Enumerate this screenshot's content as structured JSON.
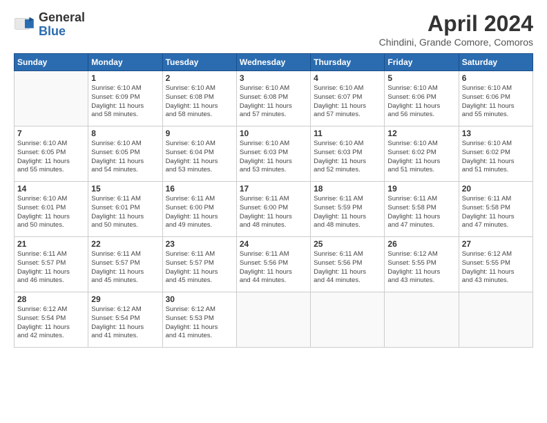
{
  "header": {
    "logo_general": "General",
    "logo_blue": "Blue",
    "month_title": "April 2024",
    "location": "Chindini, Grande Comore, Comoros"
  },
  "days_of_week": [
    "Sunday",
    "Monday",
    "Tuesday",
    "Wednesday",
    "Thursday",
    "Friday",
    "Saturday"
  ],
  "weeks": [
    [
      {
        "day": "",
        "info": ""
      },
      {
        "day": "1",
        "info": "Sunrise: 6:10 AM\nSunset: 6:09 PM\nDaylight: 11 hours\nand 58 minutes."
      },
      {
        "day": "2",
        "info": "Sunrise: 6:10 AM\nSunset: 6:08 PM\nDaylight: 11 hours\nand 58 minutes."
      },
      {
        "day": "3",
        "info": "Sunrise: 6:10 AM\nSunset: 6:08 PM\nDaylight: 11 hours\nand 57 minutes."
      },
      {
        "day": "4",
        "info": "Sunrise: 6:10 AM\nSunset: 6:07 PM\nDaylight: 11 hours\nand 57 minutes."
      },
      {
        "day": "5",
        "info": "Sunrise: 6:10 AM\nSunset: 6:06 PM\nDaylight: 11 hours\nand 56 minutes."
      },
      {
        "day": "6",
        "info": "Sunrise: 6:10 AM\nSunset: 6:06 PM\nDaylight: 11 hours\nand 55 minutes."
      }
    ],
    [
      {
        "day": "7",
        "info": "Sunrise: 6:10 AM\nSunset: 6:05 PM\nDaylight: 11 hours\nand 55 minutes."
      },
      {
        "day": "8",
        "info": "Sunrise: 6:10 AM\nSunset: 6:05 PM\nDaylight: 11 hours\nand 54 minutes."
      },
      {
        "day": "9",
        "info": "Sunrise: 6:10 AM\nSunset: 6:04 PM\nDaylight: 11 hours\nand 53 minutes."
      },
      {
        "day": "10",
        "info": "Sunrise: 6:10 AM\nSunset: 6:03 PM\nDaylight: 11 hours\nand 53 minutes."
      },
      {
        "day": "11",
        "info": "Sunrise: 6:10 AM\nSunset: 6:03 PM\nDaylight: 11 hours\nand 52 minutes."
      },
      {
        "day": "12",
        "info": "Sunrise: 6:10 AM\nSunset: 6:02 PM\nDaylight: 11 hours\nand 51 minutes."
      },
      {
        "day": "13",
        "info": "Sunrise: 6:10 AM\nSunset: 6:02 PM\nDaylight: 11 hours\nand 51 minutes."
      }
    ],
    [
      {
        "day": "14",
        "info": "Sunrise: 6:10 AM\nSunset: 6:01 PM\nDaylight: 11 hours\nand 50 minutes."
      },
      {
        "day": "15",
        "info": "Sunrise: 6:11 AM\nSunset: 6:01 PM\nDaylight: 11 hours\nand 50 minutes."
      },
      {
        "day": "16",
        "info": "Sunrise: 6:11 AM\nSunset: 6:00 PM\nDaylight: 11 hours\nand 49 minutes."
      },
      {
        "day": "17",
        "info": "Sunrise: 6:11 AM\nSunset: 6:00 PM\nDaylight: 11 hours\nand 48 minutes."
      },
      {
        "day": "18",
        "info": "Sunrise: 6:11 AM\nSunset: 5:59 PM\nDaylight: 11 hours\nand 48 minutes."
      },
      {
        "day": "19",
        "info": "Sunrise: 6:11 AM\nSunset: 5:58 PM\nDaylight: 11 hours\nand 47 minutes."
      },
      {
        "day": "20",
        "info": "Sunrise: 6:11 AM\nSunset: 5:58 PM\nDaylight: 11 hours\nand 47 minutes."
      }
    ],
    [
      {
        "day": "21",
        "info": "Sunrise: 6:11 AM\nSunset: 5:57 PM\nDaylight: 11 hours\nand 46 minutes."
      },
      {
        "day": "22",
        "info": "Sunrise: 6:11 AM\nSunset: 5:57 PM\nDaylight: 11 hours\nand 45 minutes."
      },
      {
        "day": "23",
        "info": "Sunrise: 6:11 AM\nSunset: 5:57 PM\nDaylight: 11 hours\nand 45 minutes."
      },
      {
        "day": "24",
        "info": "Sunrise: 6:11 AM\nSunset: 5:56 PM\nDaylight: 11 hours\nand 44 minutes."
      },
      {
        "day": "25",
        "info": "Sunrise: 6:11 AM\nSunset: 5:56 PM\nDaylight: 11 hours\nand 44 minutes."
      },
      {
        "day": "26",
        "info": "Sunrise: 6:12 AM\nSunset: 5:55 PM\nDaylight: 11 hours\nand 43 minutes."
      },
      {
        "day": "27",
        "info": "Sunrise: 6:12 AM\nSunset: 5:55 PM\nDaylight: 11 hours\nand 43 minutes."
      }
    ],
    [
      {
        "day": "28",
        "info": "Sunrise: 6:12 AM\nSunset: 5:54 PM\nDaylight: 11 hours\nand 42 minutes."
      },
      {
        "day": "29",
        "info": "Sunrise: 6:12 AM\nSunset: 5:54 PM\nDaylight: 11 hours\nand 41 minutes."
      },
      {
        "day": "30",
        "info": "Sunrise: 6:12 AM\nSunset: 5:53 PM\nDaylight: 11 hours\nand 41 minutes."
      },
      {
        "day": "",
        "info": ""
      },
      {
        "day": "",
        "info": ""
      },
      {
        "day": "",
        "info": ""
      },
      {
        "day": "",
        "info": ""
      }
    ]
  ]
}
